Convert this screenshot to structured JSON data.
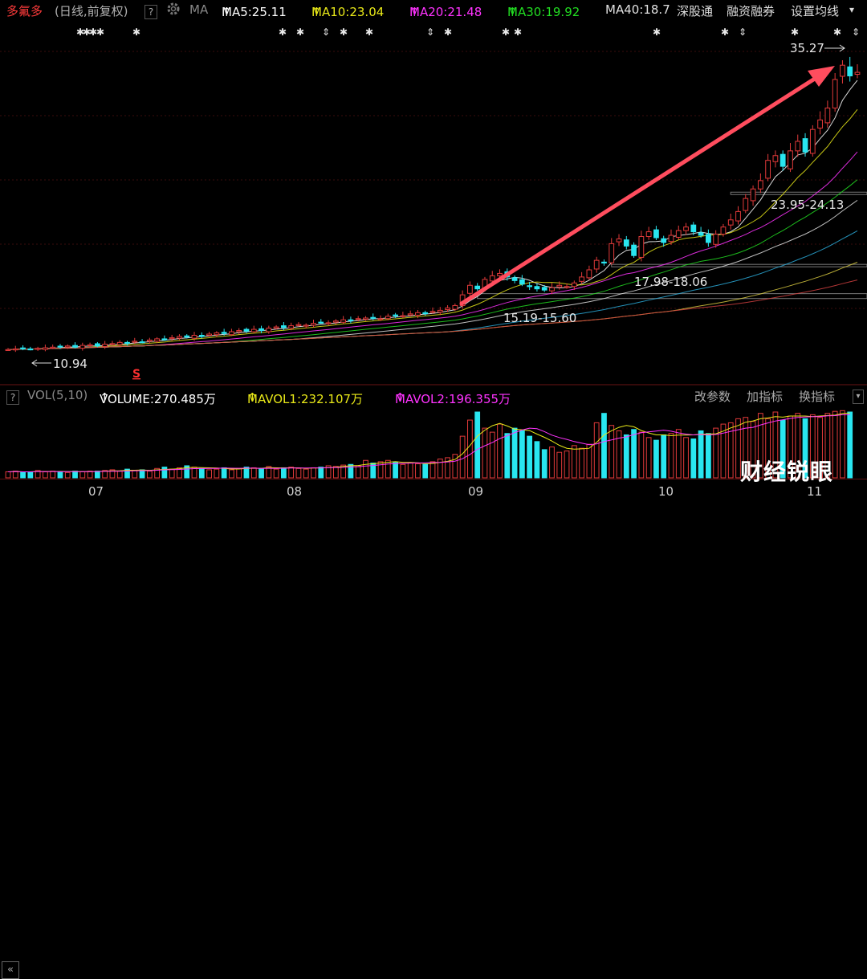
{
  "header": {
    "stock_name": "多氟多",
    "period": "(日线,前复权)",
    "help_icon": "?",
    "settings_icon": "gear-icon",
    "ma_label": "MA",
    "ma5": "MA5:25.11",
    "ma10": "MA10:23.04",
    "ma20": "MA20:21.48",
    "ma30": "MA30:19.92",
    "ma40": "MA40:18.7",
    "tab_sgt": "深股通",
    "tab_rzrq": "融资融券",
    "settings": "设置均线",
    "arrow": "↑",
    "dropdown": "▾"
  },
  "colors": {
    "up": "#e23a3a",
    "down": "#29e6f0",
    "ma5": "#ffffff",
    "ma10": "#e8e818",
    "ma20": "#ff33ff",
    "ma30": "#22dd22",
    "ma40": "#e0e0e0",
    "accent_arrow": "#ff4d5e"
  },
  "annotations": {
    "high_label": "35.27",
    "low_label": "10.94",
    "zone1": "15.19-15.60",
    "zone2": "17.98-18.06",
    "zone3": "23.95-24.13",
    "s_marker": "S"
  },
  "volume_header": {
    "help": "?",
    "vol_label": "VOL(5,10)",
    "volume": "VOLUME:270.485万",
    "mavol1": "MAVOL1:232.107万",
    "mavol2": "MAVOL2:196.355万",
    "btn_params": "改参数",
    "btn_add": "加指标",
    "btn_switch": "换指标"
  },
  "xaxis": {
    "labels": [
      "07",
      "08",
      "09",
      "10",
      "11"
    ]
  },
  "watermark": "财经锐眼",
  "chart_data": {
    "type": "candlestick",
    "title": "多氟多 (日线,前复权)",
    "x_labels": [
      "07",
      "08",
      "09",
      "10",
      "11"
    ],
    "ylim": [
      9.5,
      36.5
    ],
    "high": 35.27,
    "low": 10.94,
    "support_zones": [
      [
        15.19,
        15.6
      ],
      [
        17.98,
        18.06
      ],
      [
        23.95,
        24.13
      ]
    ],
    "moving_averages": {
      "MA5": 25.11,
      "MA10": 23.04,
      "MA20": 21.48,
      "MA30": 19.92,
      "MA40": 18.7
    },
    "volume": {
      "VOLUME": "270.485万",
      "MAVOL1": "232.107万",
      "MAVOL2": "196.355万"
    },
    "close_series": [
      10.9,
      10.95,
      11.0,
      10.94,
      11.0,
      11.05,
      11.1,
      11.15,
      11.2,
      11.1,
      11.25,
      11.3,
      11.2,
      11.35,
      11.4,
      11.5,
      11.45,
      11.6,
      11.55,
      11.7,
      11.8,
      11.75,
      11.9,
      12.0,
      11.95,
      12.1,
      12.0,
      12.2,
      12.3,
      12.25,
      12.4,
      12.5,
      12.45,
      12.6,
      12.5,
      12.7,
      12.8,
      12.75,
      12.9,
      13.0,
      12.95,
      13.1,
      13.2,
      13.15,
      13.3,
      13.4,
      13.35,
      13.5,
      13.55,
      13.6,
      13.5,
      13.7,
      13.8,
      13.75,
      13.9,
      14.0,
      13.95,
      14.1,
      14.2,
      14.4,
      14.6,
      15.5,
      16.3,
      16.0,
      16.8,
      17.1,
      17.3,
      17.0,
      16.7,
      16.4,
      16.2,
      16.0,
      15.9,
      16.1,
      16.3,
      16.2,
      16.5,
      17.0,
      17.6,
      18.4,
      18.2,
      19.8,
      20.2,
      19.6,
      18.8,
      20.4,
      20.8,
      20.3,
      19.9,
      20.5,
      20.9,
      21.2,
      20.8,
      20.5,
      19.9,
      20.6,
      21.2,
      21.8,
      22.5,
      23.6,
      24.4,
      25.1,
      26.8,
      27.2,
      26.3,
      27.6,
      28.4,
      27.5,
      29.4,
      30.2,
      31.2,
      33.6,
      34.8,
      33.9,
      34.2
    ],
    "volume_series": [
      0.9,
      1.0,
      0.8,
      0.9,
      1.1,
      0.9,
      1.0,
      0.9,
      0.8,
      1.0,
      0.9,
      1.0,
      1.0,
      1.1,
      1.2,
      1.0,
      1.3,
      1.1,
      1.2,
      1.0,
      1.4,
      1.6,
      1.3,
      1.5,
      1.8,
      1.6,
      1.4,
      1.2,
      1.3,
      1.5,
      1.2,
      1.4,
      1.6,
      1.5,
      1.4,
      1.7,
      1.3,
      1.5,
      1.6,
      1.4,
      1.3,
      1.5,
      1.6,
      1.8,
      1.7,
      1.9,
      2.0,
      1.8,
      2.6,
      2.2,
      2.4,
      2.6,
      2.3,
      2.0,
      2.2,
      2.1,
      2.0,
      2.4,
      2.8,
      3.0,
      3.5,
      6.2,
      8.6,
      9.8,
      7.4,
      6.8,
      8.0,
      6.6,
      7.4,
      7.0,
      6.2,
      5.4,
      4.2,
      4.6,
      3.8,
      4.0,
      4.8,
      4.4,
      5.0,
      8.2,
      9.6,
      7.8,
      7.0,
      6.4,
      7.2,
      6.8,
      6.0,
      5.6,
      6.4,
      6.6,
      7.2,
      6.0,
      5.8,
      7.0,
      6.6,
      7.4,
      8.0,
      8.2,
      8.8,
      9.0,
      8.4,
      9.6,
      8.8,
      9.8,
      8.6,
      9.2,
      9.6,
      8.8,
      9.4,
      9.0,
      9.6,
      9.9,
      10.0,
      9.8
    ]
  }
}
